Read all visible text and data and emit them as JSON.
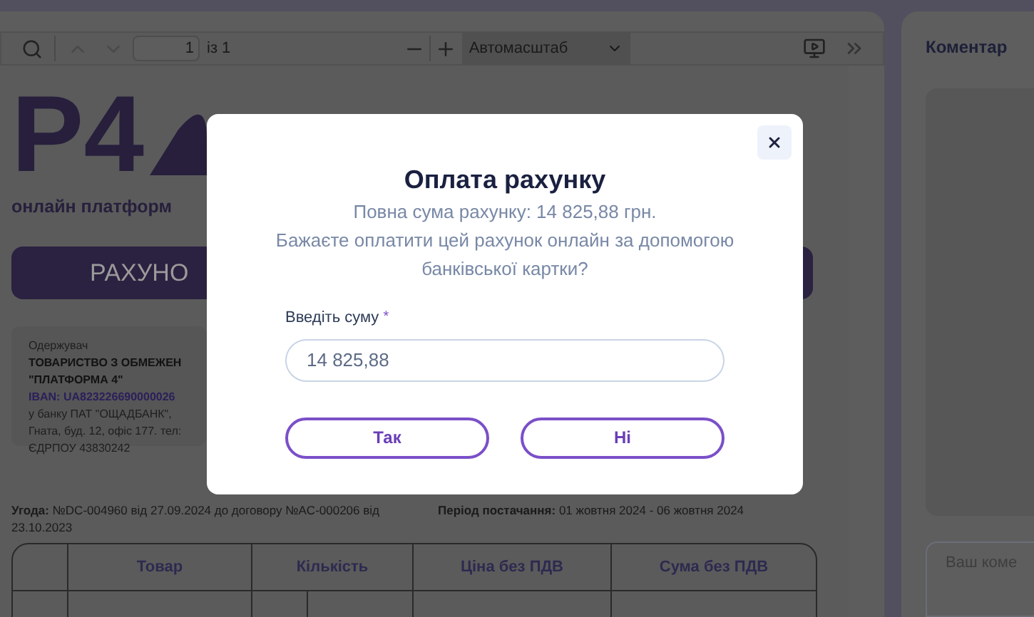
{
  "toolbar": {
    "page_input": "1",
    "page_total": "із 1",
    "zoom_select": "Автомасштаб"
  },
  "document": {
    "logo": "P4",
    "logo_tagline": "онлайн платформ",
    "banner": "РАХУНО",
    "recipient": {
      "label": "Одержувач",
      "lines": [
        {
          "kind": "bold",
          "text": "ТОВАРИСТВО З ОБМЕЖЕН"
        },
        {
          "kind": "bold",
          "text": "\"ПЛАТФОРМА 4\""
        },
        {
          "kind": "iban",
          "text": "IBAN: UA823226690000026"
        },
        {
          "kind": "plain",
          "text": "у банку ПАТ \"ОЩАДБАНК\","
        },
        {
          "kind": "plain",
          "text": "Гната, буд. 12, офіс 177. тел:"
        },
        {
          "kind": "plain",
          "text": "ЄДРПОУ 43830242"
        }
      ]
    },
    "agreement": "**Угода:** №DC-004960 від 27.09.2024 до договору №AC-000206 від 23.10.2023",
    "period": "**Період постачання:** 01 жовтня 2024 - 06 жовтня 2024",
    "table": {
      "columns": [
        "",
        "Товар",
        "Кількість",
        "Ціна без ПДВ",
        "Сума без ПДВ"
      ]
    }
  },
  "comments": {
    "title": "Коментар",
    "placeholder": "Ваш коме"
  },
  "modal": {
    "title": "Оплата рахунку",
    "total": "Повна сума рахунку: 14 825,88 грн.",
    "question": "Бажаєте оплатити цей рахунок онлайн за допомогою банківської картки?",
    "field_label": "Введіть суму",
    "required_mark": "*",
    "amount": "14 825,88",
    "buttons": [
      "Так",
      "Ні"
    ]
  }
}
